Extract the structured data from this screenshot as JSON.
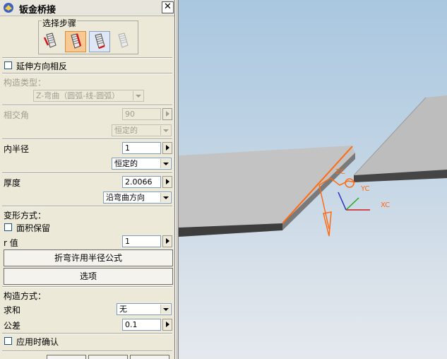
{
  "dialog": {
    "title": "钣金桥接",
    "steps_label": "选择步骤",
    "reverse_extend_label": "延伸方向相反",
    "construct_type_label": "构造类型：",
    "construct_type_value": "Z-弯曲（圆弧-线-圆弧）",
    "angle_label": "相交角",
    "angle_value": "90",
    "angle_mode": "恒定的",
    "inner_radius_label": "内半径",
    "inner_radius_value": "1",
    "inner_radius_mode": "恒定的",
    "thickness_label": "厚度",
    "thickness_value": "2.0066",
    "thickness_mode": "沿弯曲方向",
    "deform_label": "变形方式：",
    "preserve_area_label": "面积保留",
    "r_value_label": "r 值",
    "r_value": "1",
    "formula_button": "折弯许用半径公式",
    "options_button": "选项",
    "construct_method_label": "构造方式：",
    "sum_label": "求和",
    "sum_value": "无",
    "tolerance_label": "公差",
    "tolerance_value": "0.1",
    "confirm_label": "应用时确认"
  },
  "viewport": {
    "axis_labels": {
      "zc": "ZC",
      "yc": "YC",
      "xc": "XC"
    },
    "colors": {
      "highlight": "#ff6a10",
      "plate_top": "#c0c0c0",
      "plate_edge": "#3a3a3a",
      "axis_y": "#22a822",
      "axis_z": "#2030c8",
      "axis_x": "#d01818"
    }
  }
}
